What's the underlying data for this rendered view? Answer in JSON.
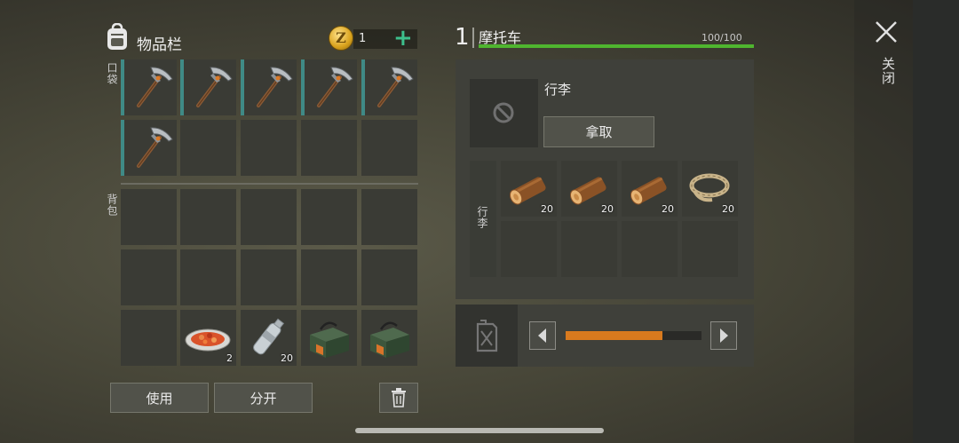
{
  "inventory": {
    "title": "物品栏",
    "coins": "1",
    "coin_symbol": "Z",
    "plus": "+",
    "pocket_label": "口袋",
    "backpack_label": "背包"
  },
  "pocket_items": [
    {
      "icon": "pickaxe-icon"
    },
    {
      "icon": "pickaxe-icon"
    },
    {
      "icon": "pickaxe-icon"
    },
    {
      "icon": "pickaxe-icon"
    },
    {
      "icon": "pickaxe-icon"
    },
    {
      "icon": "pickaxe-icon"
    }
  ],
  "backpack_items": [
    {
      "slot": 11,
      "icon": "food-plate-icon",
      "qty": "2"
    },
    {
      "slot": 12,
      "icon": "water-bottle-icon",
      "qty": "20"
    },
    {
      "slot": 13,
      "icon": "ammo-box-icon",
      "qty": ""
    },
    {
      "slot": 14,
      "icon": "ammo-box-icon",
      "qty": ""
    }
  ],
  "buttons": {
    "use": "使用",
    "split": "分开"
  },
  "vehicle": {
    "number": "1",
    "name": "摩托车",
    "hp": "100/100",
    "hp_fraction": 1.0,
    "trunk_name": "行李",
    "take": "拿取",
    "trunk_label": "行李",
    "fuel_fraction": 0.71
  },
  "trunk_items": [
    {
      "icon": "wood-log-icon",
      "qty": "20"
    },
    {
      "icon": "wood-log-icon",
      "qty": "20"
    },
    {
      "icon": "wood-log-icon",
      "qty": "20"
    },
    {
      "icon": "rope-icon",
      "qty": "20"
    }
  ],
  "close_label": "关闭",
  "colors": {
    "accent": "#3dbf8c",
    "hp": "#4fb52f",
    "fuel": "#d97a1e",
    "equip_marker": "#3f8a86"
  }
}
